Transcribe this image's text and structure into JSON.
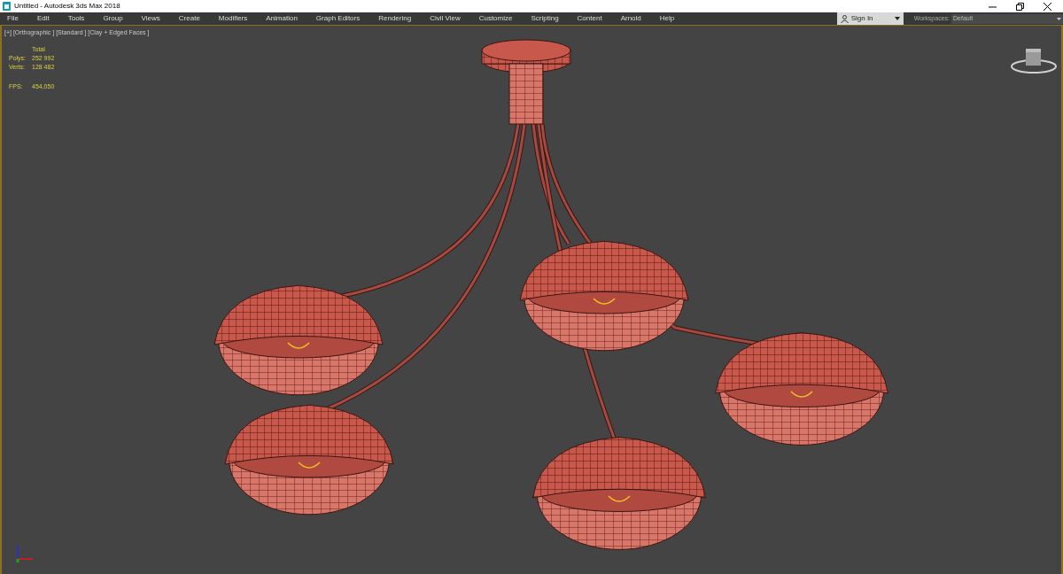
{
  "window": {
    "title": "Untitled - Autodesk 3ds Max 2018"
  },
  "menu": [
    "File",
    "Edit",
    "Tools",
    "Group",
    "Views",
    "Create",
    "Modifiers",
    "Animation",
    "Graph Editors",
    "Rendering",
    "Civil View",
    "Customize",
    "Scripting",
    "Content",
    "Arnold",
    "Help"
  ],
  "sign_in": {
    "label": "Sign In"
  },
  "workspaces": {
    "label": "Workspaces:",
    "value": "Default"
  },
  "viewport": {
    "label": "[+] [Orthographic ] [Standard ] [Clay + Edged Faces ]",
    "stats": {
      "header": "Total",
      "rows": [
        {
          "label": "Polys:",
          "value": "252 992"
        },
        {
          "label": "Verts:",
          "value": "128 482"
        }
      ],
      "fps": {
        "label": "FPS:",
        "value": "454,050"
      }
    }
  }
}
